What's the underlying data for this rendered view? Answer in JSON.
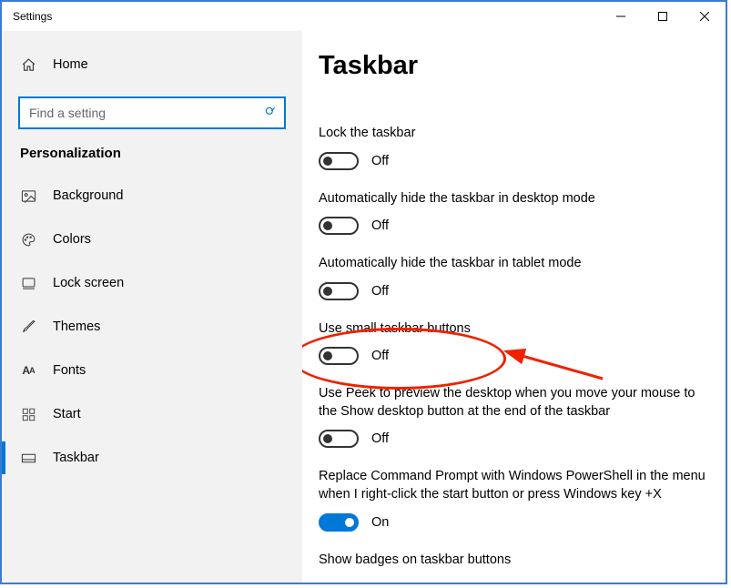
{
  "window": {
    "title": "Settings"
  },
  "sidebar": {
    "home_label": "Home",
    "search_placeholder": "Find a setting",
    "section_label": "Personalization",
    "items": [
      {
        "label": "Background"
      },
      {
        "label": "Colors"
      },
      {
        "label": "Lock screen"
      },
      {
        "label": "Themes"
      },
      {
        "label": "Fonts"
      },
      {
        "label": "Start"
      },
      {
        "label": "Taskbar"
      }
    ]
  },
  "page": {
    "title": "Taskbar",
    "state_off": "Off",
    "state_on": "On",
    "settings": [
      {
        "label": "Lock the taskbar",
        "on": false
      },
      {
        "label": "Automatically hide the taskbar in desktop mode",
        "on": false
      },
      {
        "label": "Automatically hide the taskbar in tablet mode",
        "on": false
      },
      {
        "label": "Use small taskbar buttons",
        "on": false
      },
      {
        "label": "Use Peek to preview the desktop when you move your mouse to the Show desktop button at the end of the taskbar",
        "on": false
      },
      {
        "label": "Replace Command Prompt with Windows PowerShell in the menu when I right-click the start button or press Windows key +X",
        "on": true
      },
      {
        "label": "Show badges on taskbar buttons",
        "on": true
      }
    ]
  },
  "annotation": {
    "highlighted_setting": "Use small taskbar buttons",
    "colors": {
      "red": "#e20"
    }
  }
}
